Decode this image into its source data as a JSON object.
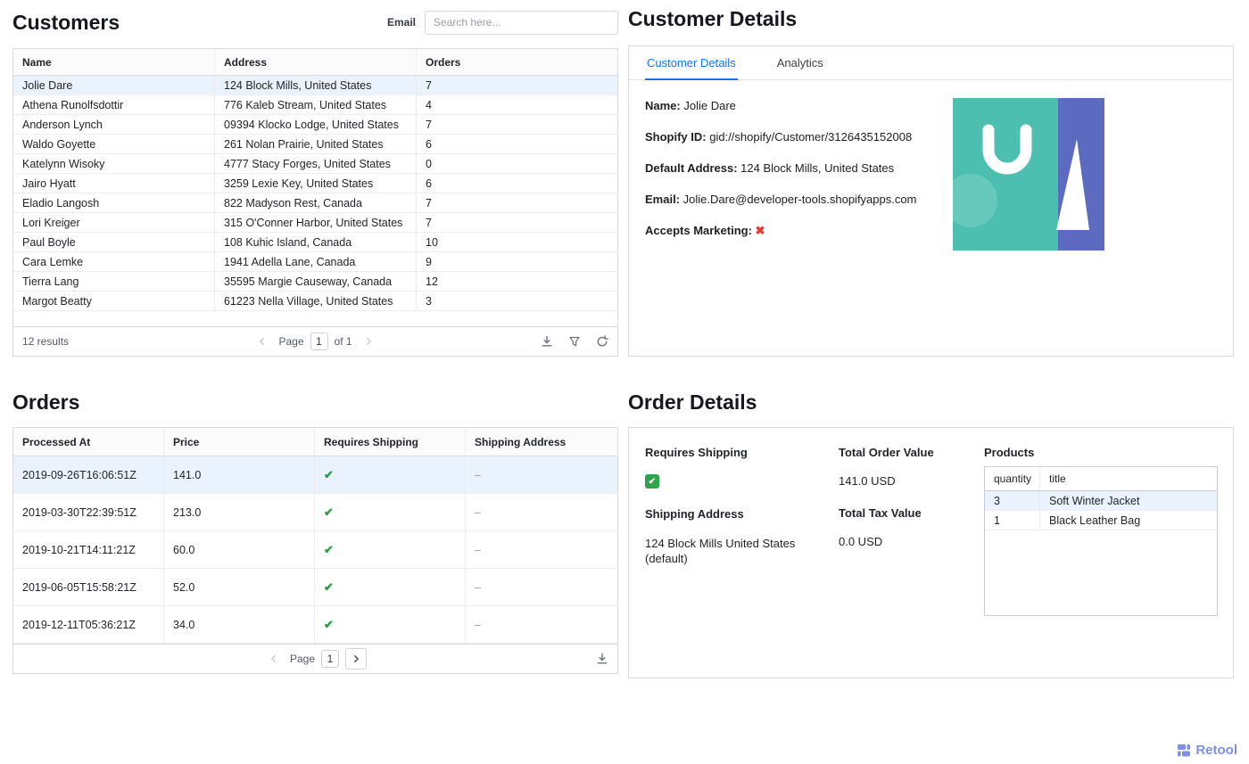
{
  "colors": {
    "accent": "#1a73e8",
    "selected_row": "#e9f2fd",
    "check_green": "#2e9e44",
    "cross_red": "#e23b2e",
    "avatar_teal": "#4dbfb0",
    "avatar_indigo": "#5c6bc0",
    "logo_blue": "#7d90e3"
  },
  "icons": {
    "red_cross": "✖",
    "white_check": "✔"
  },
  "customers": {
    "title": "Customers",
    "search": {
      "label": "Email",
      "placeholder": "Search here..."
    },
    "columns": {
      "name": "Name",
      "address": "Address",
      "orders": "Orders"
    },
    "rows": [
      {
        "name": "Jolie Dare",
        "address": "124 Block Mills, United States",
        "orders": "7"
      },
      {
        "name": "Athena Runolfsdottir",
        "address": "776 Kaleb Stream, United States",
        "orders": "4"
      },
      {
        "name": "Anderson Lynch",
        "address": "09394 Klocko Lodge, United States",
        "orders": "7"
      },
      {
        "name": "Waldo Goyette",
        "address": "261 Nolan Prairie, United States",
        "orders": "6"
      },
      {
        "name": "Katelynn Wisoky",
        "address": "4777 Stacy Forges, United States",
        "orders": "0"
      },
      {
        "name": "Jairo Hyatt",
        "address": "3259 Lexie Key, United States",
        "orders": "6"
      },
      {
        "name": "Eladio Langosh",
        "address": "822 Madyson Rest, Canada",
        "orders": "7"
      },
      {
        "name": "Lori Kreiger",
        "address": "315 O'Conner Harbor, United States",
        "orders": "7"
      },
      {
        "name": "Paul Boyle",
        "address": "108 Kuhic Island, Canada",
        "orders": "10"
      },
      {
        "name": "Cara Lemke",
        "address": "1941 Adella Lane, Canada",
        "orders": "9"
      },
      {
        "name": "Tierra Lang",
        "address": "35595 Margie Causeway, Canada",
        "orders": "12"
      },
      {
        "name": "Margot Beatty",
        "address": "61223 Nella Village, United States",
        "orders": "3"
      }
    ],
    "footer": {
      "results": "12 results",
      "page_label": "Page",
      "page_value": "1",
      "of_label": "of 1"
    }
  },
  "customer_details": {
    "title": "Customer Details",
    "tabs": {
      "details": "Customer Details",
      "analytics": "Analytics"
    },
    "fields": {
      "name_label": "Name:",
      "name_value": "Jolie Dare",
      "shopify_id_label": "Shopify ID:",
      "shopify_id_value": "gid://shopify/Customer/3126435152008",
      "default_address_label": "Default Address:",
      "default_address_value": "124 Block Mills, United States",
      "email_label": "Email:",
      "email_value": "Jolie.Dare@developer-tools.shopifyapps.com",
      "accepts_marketing_label": "Accepts Marketing:"
    }
  },
  "orders": {
    "title": "Orders",
    "columns": {
      "processed_at": "Processed At",
      "price": "Price",
      "requires_shipping": "Requires Shipping",
      "shipping_address": "Shipping Address"
    },
    "rows": [
      {
        "processed_at": "2019-09-26T16:06:51Z",
        "price": "141.0",
        "requires_shipping": "✔",
        "shipping_address": "–"
      },
      {
        "processed_at": "2019-03-30T22:39:51Z",
        "price": "213.0",
        "requires_shipping": "✔",
        "shipping_address": "–"
      },
      {
        "processed_at": "2019-10-21T14:11:21Z",
        "price": "60.0",
        "requires_shipping": "✔",
        "shipping_address": "–"
      },
      {
        "processed_at": "2019-06-05T15:58:21Z",
        "price": "52.0",
        "requires_shipping": "✔",
        "shipping_address": "–"
      },
      {
        "processed_at": "2019-12-11T05:36:21Z",
        "price": "34.0",
        "requires_shipping": "✔",
        "shipping_address": "–"
      }
    ],
    "footer": {
      "page_label": "Page",
      "page_value": "1"
    }
  },
  "order_details": {
    "title": "Order Details",
    "requires_shipping_label": "Requires Shipping",
    "shipping_address_label": "Shipping Address",
    "shipping_address_value": "124 Block Mills United States (default)",
    "total_order_label": "Total Order Value",
    "total_order_value": "141.0 USD",
    "total_tax_label": "Total Tax Value",
    "total_tax_value": "0.0 USD",
    "products_label": "Products",
    "products_columns": {
      "quantity": "quantity",
      "title": "title"
    },
    "products": [
      {
        "quantity": "3",
        "title": "Soft Winter Jacket"
      },
      {
        "quantity": "1",
        "title": "Black Leather Bag"
      }
    ]
  },
  "branding": {
    "logo_text": "Retool"
  }
}
